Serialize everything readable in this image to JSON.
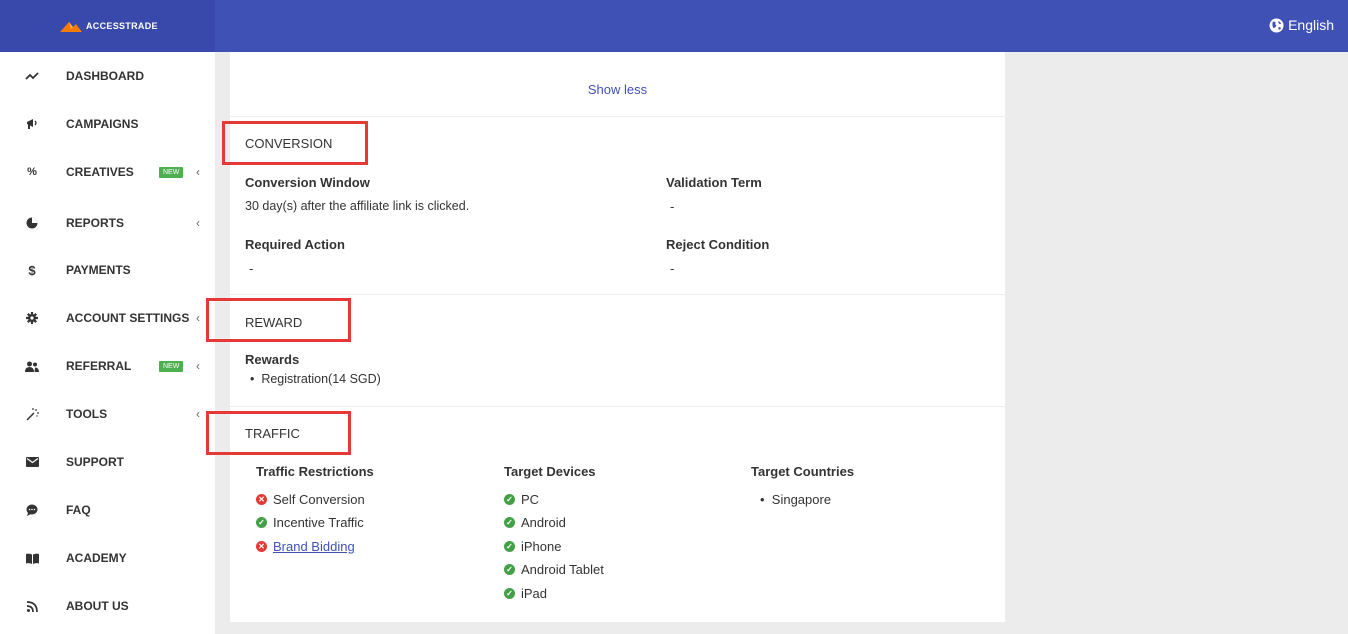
{
  "header": {
    "brand": "ACCESSTRADE",
    "language": "English"
  },
  "sidebar": {
    "items": [
      {
        "label": "DASHBOARD",
        "icon": "trending-up-icon"
      },
      {
        "label": "CAMPAIGNS",
        "icon": "megaphone-icon"
      },
      {
        "label": "CREATIVES",
        "icon": "percent-icon",
        "badge": "NEW"
      },
      {
        "label": "REPORTS",
        "icon": "pie-chart-icon"
      },
      {
        "label": "PAYMENTS",
        "icon": "dollar-icon"
      },
      {
        "label": "ACCOUNT SETTINGS",
        "icon": "gear-icon"
      },
      {
        "label": "REFERRAL",
        "icon": "users-icon",
        "badge": "NEW"
      },
      {
        "label": "TOOLS",
        "icon": "magic-wand-icon"
      },
      {
        "label": "SUPPORT",
        "icon": "envelope-icon"
      },
      {
        "label": "FAQ",
        "icon": "chat-bubble-icon"
      },
      {
        "label": "ACADEMY",
        "icon": "book-icon"
      },
      {
        "label": "ABOUT US",
        "icon": "rss-icon"
      }
    ]
  },
  "main": {
    "show_less": "Show less",
    "conversion": {
      "title": "CONVERSION",
      "window_label": "Conversion Window",
      "window_value": "30 day(s) after the affiliate link is clicked.",
      "validation_label": "Validation Term",
      "validation_value": "-",
      "required_label": "Required Action",
      "required_value": "-",
      "reject_label": "Reject Condition",
      "reject_value": "-"
    },
    "reward": {
      "title": "REWARD",
      "rewards_label": "Rewards",
      "items": [
        "Registration(14 SGD)"
      ]
    },
    "traffic": {
      "title": "TRAFFIC",
      "restrictions_label": "Traffic Restrictions",
      "restrictions": [
        {
          "label": "Self Conversion",
          "status": "not-allowed"
        },
        {
          "label": "Incentive Traffic",
          "status": "allowed"
        },
        {
          "label": "Brand Bidding",
          "status": "not-allowed"
        }
      ],
      "devices_label": "Target Devices",
      "devices": [
        "PC",
        "Android",
        "iPhone",
        "Android Tablet",
        "iPad"
      ],
      "countries_label": "Target Countries",
      "countries": [
        "Singapore"
      ]
    }
  },
  "colors": {
    "primary": "#3f51b5",
    "highlight_box": "#e53935",
    "allowed": "#43a047",
    "not_allowed": "#e53935",
    "badge": "#4caf50"
  }
}
